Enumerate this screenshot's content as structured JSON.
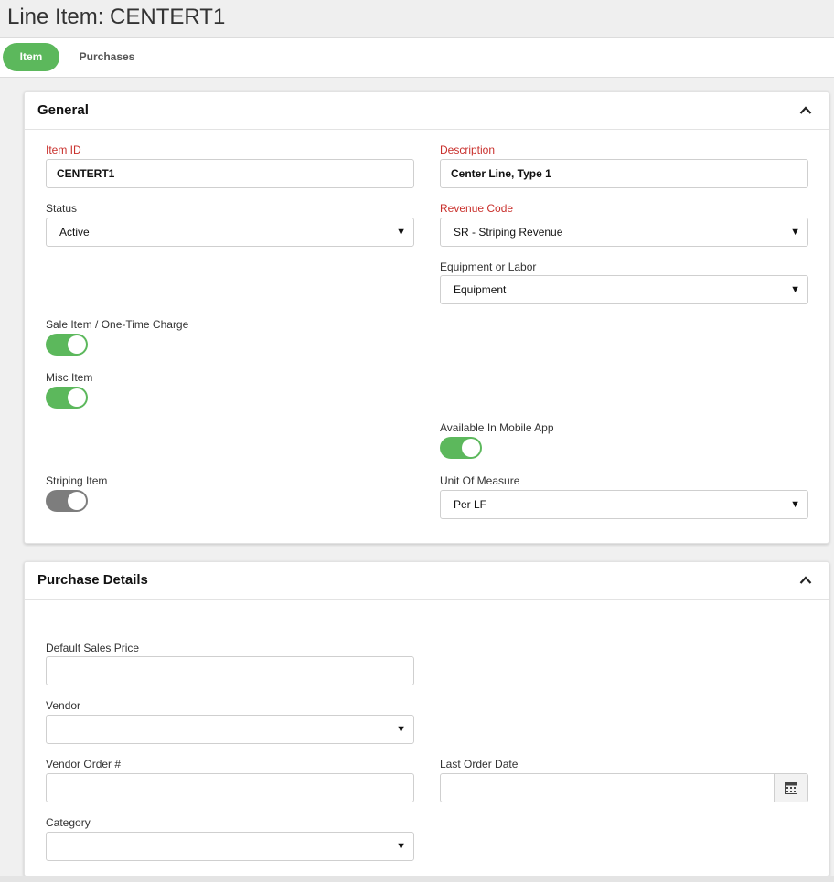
{
  "page": {
    "title": "Line Item: CENTERT1"
  },
  "tabs": [
    {
      "label": "Item",
      "active": true
    },
    {
      "label": "Purchases",
      "active": false
    }
  ],
  "colors": {
    "accent": "#5cb85c",
    "required": "#c9302c",
    "toggle_off": "#7d7d7d"
  },
  "general": {
    "title": "General",
    "collapse_icon": "chevron-up-icon",
    "item_id": {
      "label": "Item ID",
      "value": "CENTERT1",
      "required": true
    },
    "description": {
      "label": "Description",
      "value": "Center Line, Type 1",
      "required": true
    },
    "status": {
      "label": "Status",
      "value": "Active"
    },
    "revenue_code": {
      "label": "Revenue Code",
      "value": "SR - Striping Revenue",
      "required": true
    },
    "equipment_or_labor": {
      "label": "Equipment or Labor",
      "value": "Equipment"
    },
    "sale_item": {
      "label": "Sale Item / One-Time Charge",
      "on": true
    },
    "misc_item": {
      "label": "Misc Item",
      "on": true
    },
    "available_mobile": {
      "label": "Available In Mobile App",
      "on": true
    },
    "striping_item": {
      "label": "Striping Item",
      "on": false
    },
    "unit_of_measure": {
      "label": "Unit Of Measure",
      "value": "Per LF"
    }
  },
  "purchase": {
    "title": "Purchase Details",
    "collapse_icon": "chevron-up-icon",
    "default_sales_price": {
      "label": "Default Sales Price",
      "value": ""
    },
    "vendor": {
      "label": "Vendor",
      "value": ""
    },
    "vendor_order": {
      "label": "Vendor Order #",
      "value": ""
    },
    "last_order_date": {
      "label": "Last Order Date",
      "value": "",
      "icon": "calendar-icon"
    },
    "category": {
      "label": "Category",
      "value": ""
    }
  },
  "dropdown_arrow": "▼"
}
